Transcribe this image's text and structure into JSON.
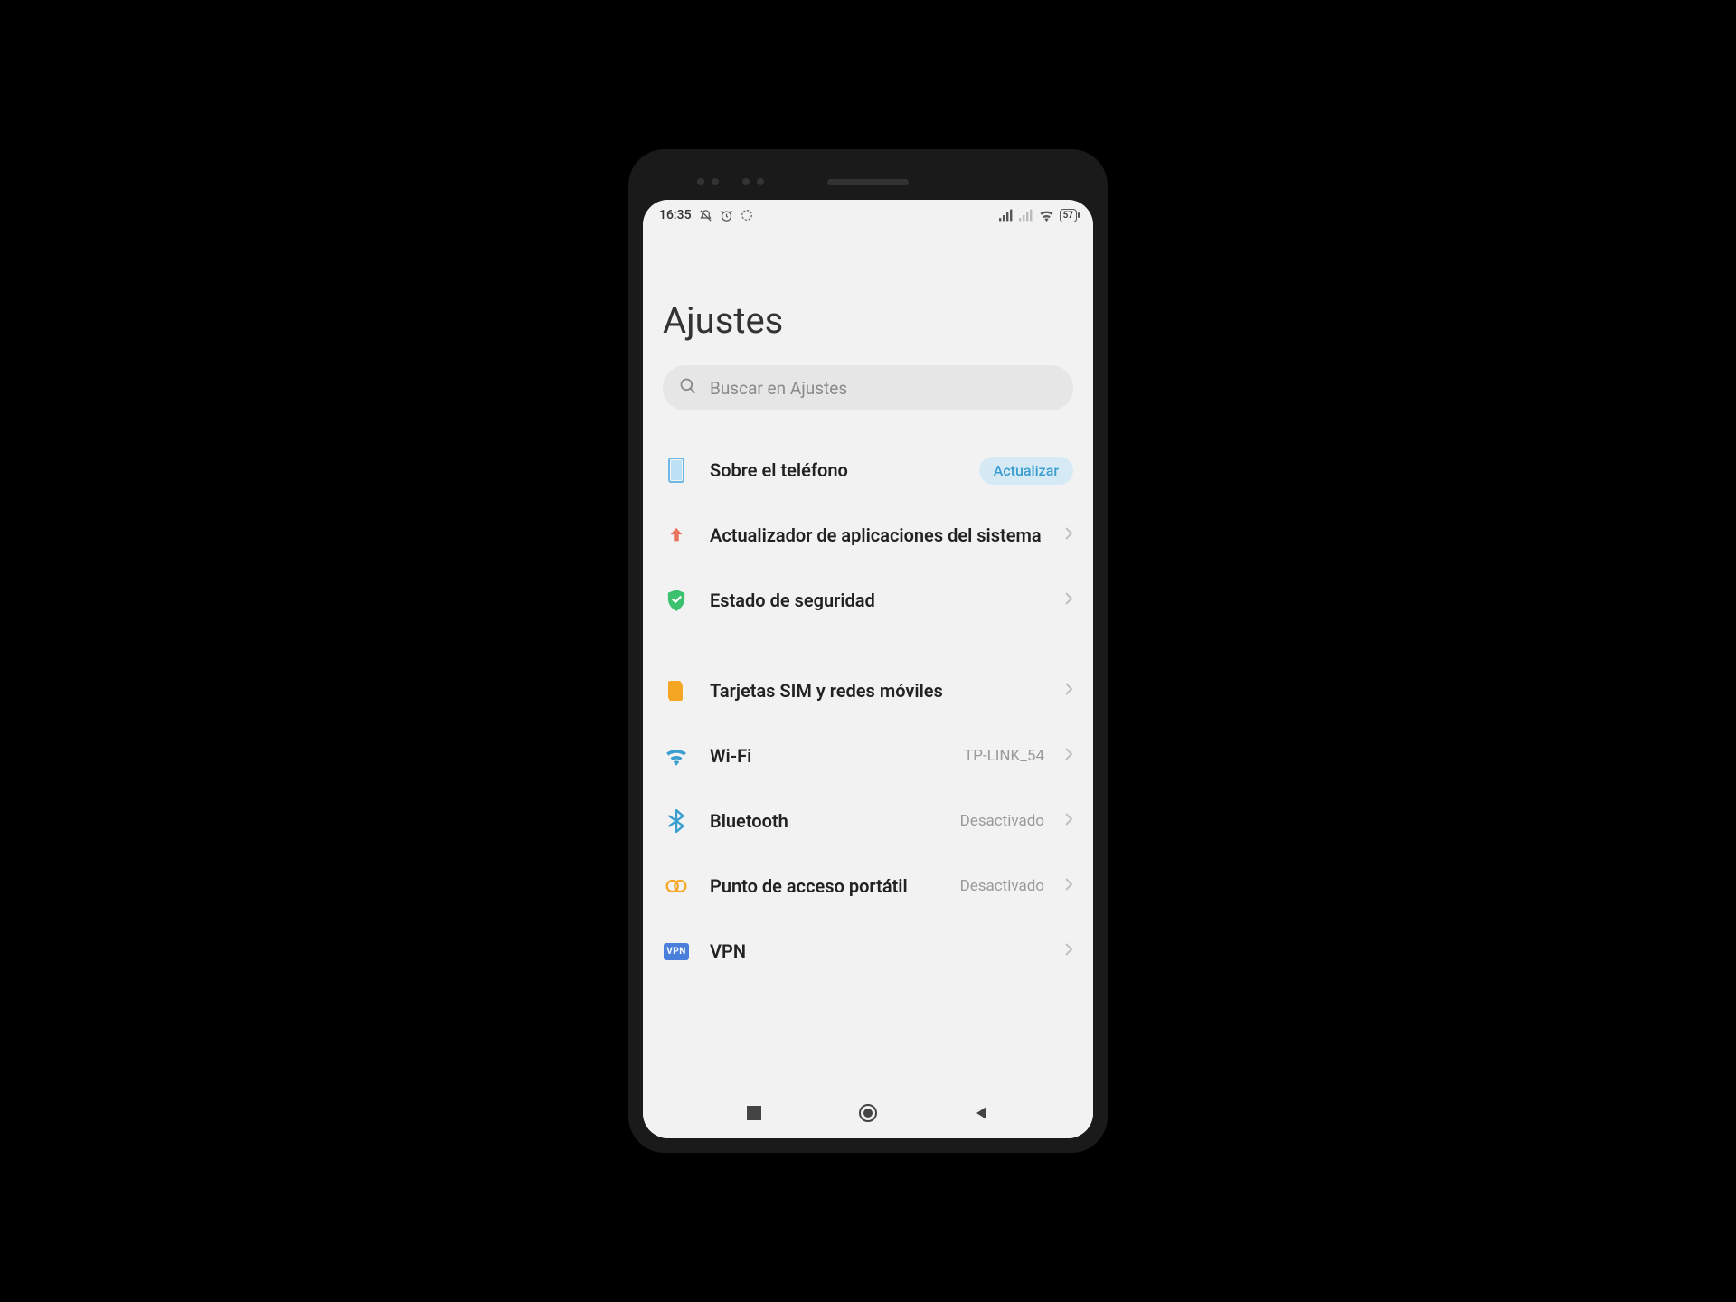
{
  "statusbar": {
    "time": "16:35",
    "battery": "57"
  },
  "page": {
    "title": "Ajustes"
  },
  "search": {
    "placeholder": "Buscar en Ajustes"
  },
  "items": {
    "about": {
      "label": "Sobre el teléfono",
      "badge": "Actualizar"
    },
    "updater": {
      "label": "Actualizador de aplicaciones del sistema"
    },
    "security": {
      "label": "Estado de seguridad"
    },
    "sim": {
      "label": "Tarjetas SIM y redes móviles"
    },
    "wifi": {
      "label": "Wi-Fi",
      "value": "TP-LINK_54"
    },
    "bluetooth": {
      "label": "Bluetooth",
      "value": "Desactivado"
    },
    "hotspot": {
      "label": "Punto de acceso portátil",
      "value": "Desactivado"
    },
    "vpn": {
      "label": "VPN"
    }
  }
}
